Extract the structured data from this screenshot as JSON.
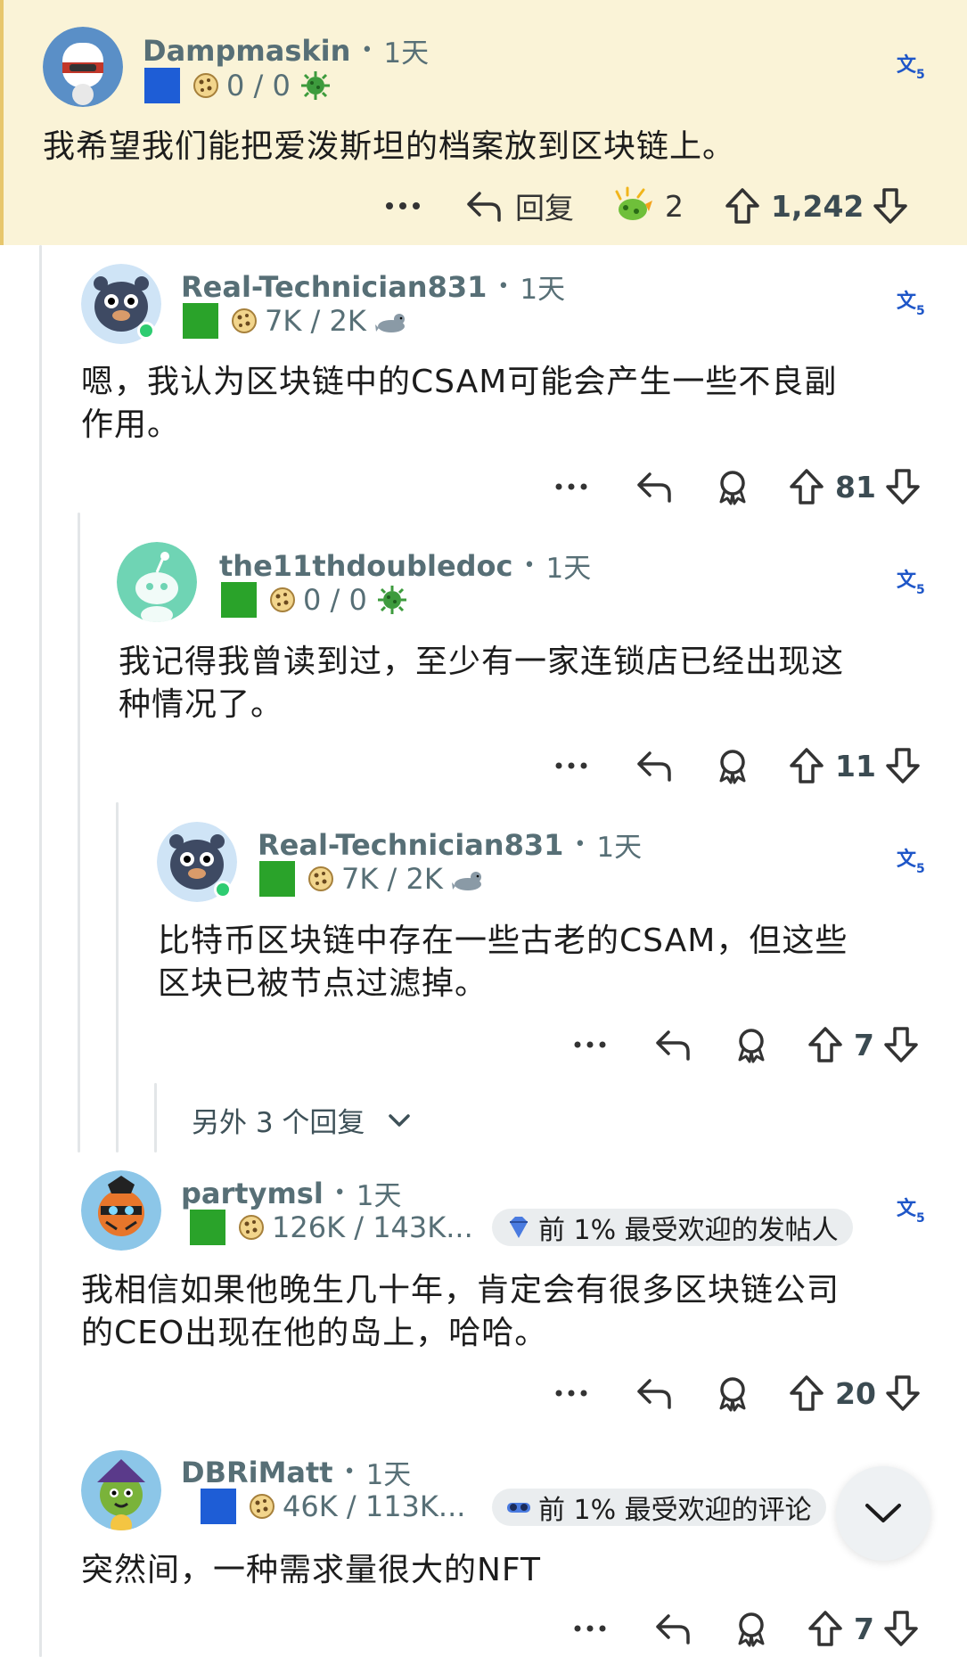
{
  "comments": [
    {
      "username": "Dampmaskin",
      "age": "1天",
      "flair_square": "blue",
      "karma": "0 / 0",
      "extra_icon": "virus-icon",
      "text": "我希望我们能把爱泼斯坦的档案放到区块链上。",
      "reply_label": "回复",
      "award_count": "2",
      "votes": "1,242",
      "highlighted": true
    },
    {
      "username": "Real-Technician831",
      "age": "1天",
      "flair_square": "green",
      "karma": "7K / 2K",
      "extra_icon": "seal-icon",
      "text_line1": "嗯，我认为区块链中的CSAM可能会产生一些不良副",
      "text_line2": "作用。",
      "votes": "81",
      "online": true
    },
    {
      "username": "the11thdoubledoc",
      "age": "1天",
      "flair_square": "green",
      "karma": "0 / 0",
      "extra_icon": "virus-icon",
      "text_line1": "我记得我曾读到过，至少有一家连锁店已经出现这",
      "text_line2": "种情况了。",
      "votes": "11"
    },
    {
      "username": "Real-Technician831",
      "age": "1天",
      "flair_square": "green",
      "karma": "7K / 2K",
      "extra_icon": "seal-icon",
      "text_line1": "比特币区块链中存在一些古老的CSAM，但这些",
      "text_line2": "区块已被节点过滤掉。",
      "votes": "7",
      "online": true
    },
    {
      "username": "partymsl",
      "age": "1天",
      "flair_square": "green",
      "karma": "126K / 143K...",
      "badge": "前 1% 最受欢迎的发帖人",
      "text_line1": "我相信如果他晚生几十年，肯定会有很多区块链公司",
      "text_line2": "的CEO出现在他的岛上，哈哈。",
      "votes": "20"
    },
    {
      "username": "DBRiMatt",
      "age": "1天",
      "flair_square": "blue",
      "karma": "46K / 113K...",
      "badge": "前 1% 最受欢迎的评论",
      "text_line1": "突然间，一种需求量很大的NFT",
      "votes": "7"
    }
  ],
  "more_replies": "另外 3 个回复",
  "colors": {
    "highlight_bg": "#faf3d7",
    "highlight_border": "#e7c66c",
    "meta_text": "#576f76",
    "thread_line": "#e3e6e8"
  }
}
